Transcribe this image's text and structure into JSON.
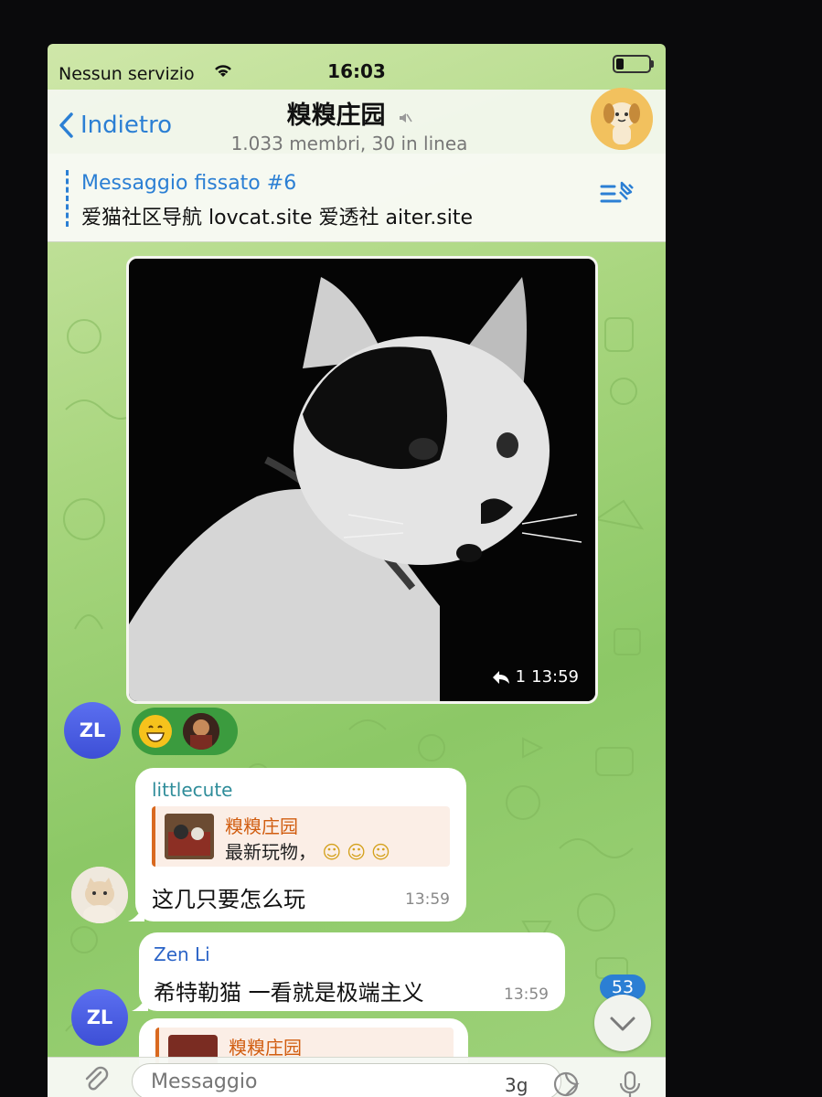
{
  "status": {
    "carrier": "Nessun servizio",
    "time": "16:03"
  },
  "header": {
    "back_label": "Indietro",
    "title": "糗糗庄园",
    "subtitle": "1.033 membri, 30 in linea"
  },
  "pinned": {
    "label": "Messaggio fissato #6",
    "text": "爱猫社区导航 lovcat.site 爱透社 aiter.site"
  },
  "photo_message": {
    "reply_count": "1",
    "time": "13:59"
  },
  "messages": [
    {
      "avatar_initials": "ZL"
    },
    {
      "sender": "littlecute",
      "reply_name": "糗糗庄园",
      "reply_text": "最新玩物，",
      "reply_emoji": "☺☺☺",
      "text": "这几只要怎么玩",
      "time": "13:59"
    },
    {
      "sender": "Zen Li",
      "text": "希特勒猫 一看就是极端主义",
      "time": "13:59",
      "avatar_initials": "ZL"
    },
    {
      "reply_name": "糗糗庄园"
    }
  ],
  "unread_badge": "53",
  "composer": {
    "placeholder": "Messaggio",
    "sticker_hint": "3g"
  },
  "colors": {
    "accent": "#2b7fd4",
    "reply_accent": "#d9691f",
    "reactions_bg": "#3b9b3e",
    "background_green": "#a9d67f"
  },
  "icons": {
    "back": "chevron-left-icon",
    "mute": "speaker-muted-icon",
    "pinned_list": "pinned-list-icon",
    "reply": "reply-arrow-icon",
    "scroll_down": "chevron-down-icon",
    "attach": "paperclip-icon",
    "sticker": "sticker-icon",
    "mic": "microphone-icon"
  }
}
